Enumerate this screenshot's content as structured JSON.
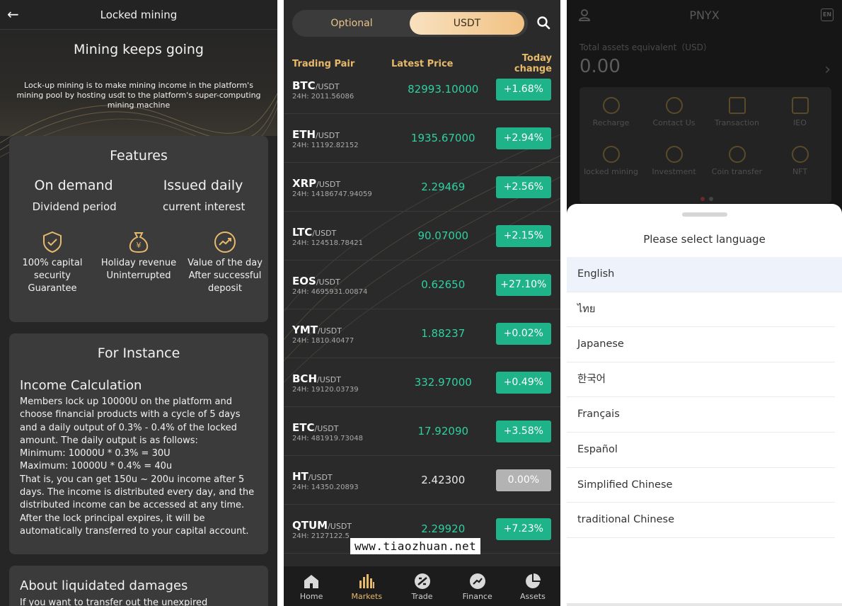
{
  "locked": {
    "header_title": "Locked mining",
    "hero_title": "Mining keeps going",
    "hero_desc": "Lock-up mining is to make mining income in the platform's mining pool by hosting usdt to the platform's super-computing mining machine",
    "features_title": "Features",
    "feature_big_1": "On demand",
    "feature_big_2": "Issued daily",
    "feature_small_1": "Dividend period",
    "feature_small_2": "current interest",
    "feature_icon_items": [
      {
        "icon": "shield-check-icon",
        "label": "100% capital security Guarantee"
      },
      {
        "icon": "money-bag-icon",
        "label": "Holiday revenue Uninterrupted"
      },
      {
        "icon": "trend-up-icon",
        "label": "Value of the day After successful deposit"
      }
    ],
    "instance_title": "For Instance",
    "income_title": "Income Calculation",
    "income_text": "Members lock up 10000U on the platform and choose financial products with a cycle of 5 days and a daily output of 0.3% - 0.4% of the locked amount. The daily output is as follows:\nMinimum: 10000U * 0.3% = 30U\nMaximum: 10000U * 0.4% = 40u\nThat is, you can get 150u ~ 200u income after 5 days. The income is distributed every day, and the distributed income can be accessed at any time. After the lock principal expires, it will be automatically transferred to your capital account.",
    "liquidated_title": "About liquidated damages",
    "liquidated_text": "If you want to transfer out the unexpired"
  },
  "markets": {
    "tab_optional": "Optional",
    "tab_usdt": "USDT",
    "col_pair": "Trading Pair",
    "col_price": "Latest Price",
    "col_change": "Today change",
    "rows": [
      {
        "sym": "BTC",
        "quote": "/USDT",
        "vol": "24H: 2011.56086",
        "price": "82993.10000",
        "change": "+1.68%"
      },
      {
        "sym": "ETH",
        "quote": "/USDT",
        "vol": "24H: 11192.82152",
        "price": "1935.67000",
        "change": "+2.94%"
      },
      {
        "sym": "XRP",
        "quote": "/USDT",
        "vol": "24H: 14186747.94059",
        "price": "2.29469",
        "change": "+2.56%"
      },
      {
        "sym": "LTC",
        "quote": "/USDT",
        "vol": "24H: 124518.78421",
        "price": "90.07000",
        "change": "+2.15%"
      },
      {
        "sym": "EOS",
        "quote": "/USDT",
        "vol": "24H: 4695931.00874",
        "price": "0.62650",
        "change": "+27.10%"
      },
      {
        "sym": "YMT",
        "quote": "/USDT",
        "vol": "24H: 1810.40477",
        "price": "1.88237",
        "change": "+0.02%"
      },
      {
        "sym": "BCH",
        "quote": "/USDT",
        "vol": "24H: 19120.03739",
        "price": "332.97000",
        "change": "+0.49%"
      },
      {
        "sym": "ETC",
        "quote": "/USDT",
        "vol": "24H: 481919.73048",
        "price": "17.92090",
        "change": "+3.58%"
      },
      {
        "sym": "HT",
        "quote": "/USDT",
        "vol": "24H: 14350.20893",
        "price": "2.42300",
        "change": "0.00%"
      },
      {
        "sym": "QTUM",
        "quote": "/USDT",
        "vol": "24H: 2127122.5",
        "price": "2.29920",
        "change": "+7.23%"
      }
    ],
    "watermark": "www.tiaozhuan.net",
    "nav": [
      {
        "label": "Home",
        "icon": "home-icon"
      },
      {
        "label": "Markets",
        "icon": "bars-icon"
      },
      {
        "label": "Trade",
        "icon": "trade-icon"
      },
      {
        "label": "Finance",
        "icon": "finance-icon"
      },
      {
        "label": "Assets",
        "icon": "pie-icon"
      }
    ]
  },
  "assets": {
    "title": "PNYX",
    "lang_badge": "EN",
    "total_label": "Total assets equivalent（USD）",
    "total_value": "0.00",
    "grid": [
      {
        "label": "Recharge",
        "icon": "bitcoin-icon"
      },
      {
        "label": "Contact Us",
        "icon": "chat-icon"
      },
      {
        "label": "Transaction",
        "icon": "chart-icon"
      },
      {
        "label": "IEO",
        "icon": "edit-icon"
      },
      {
        "label": "locked mining",
        "icon": "coin-icon"
      },
      {
        "label": "Investment",
        "icon": "target-icon"
      },
      {
        "label": "Coin transfer",
        "icon": "transfer-icon"
      },
      {
        "label": "NFT",
        "icon": "nft-icon"
      }
    ],
    "sheet_title": "Please select language",
    "languages": [
      "English",
      "ไทย",
      "Japanese",
      "한국어",
      "Français",
      "Español",
      "Simplified Chinese",
      "traditional Chinese"
    ]
  },
  "colors": {
    "accent_gold": "#e7b96b",
    "green": "#1fb38a",
    "flat": "#b3b3b3"
  }
}
